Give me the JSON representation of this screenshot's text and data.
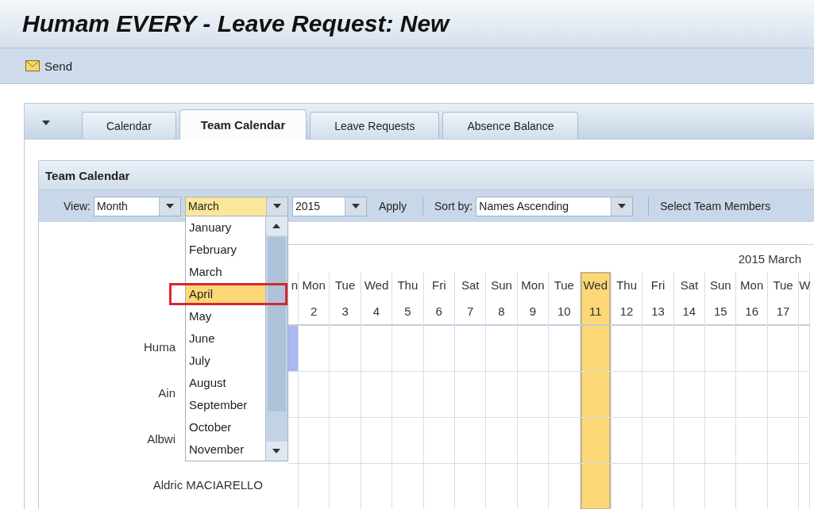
{
  "window": {
    "title": "Humam EVERY - Leave Request: New"
  },
  "toolbar": {
    "buttons": [
      {
        "label": "Send"
      }
    ]
  },
  "tabs": [
    {
      "label": "Calendar",
      "selected": false
    },
    {
      "label": "Team Calendar",
      "selected": true
    },
    {
      "label": "Leave Requests",
      "selected": false
    },
    {
      "label": "Absence Balance",
      "selected": false
    }
  ],
  "panel": {
    "title": "Team Calendar"
  },
  "filters": {
    "view_label": "View:",
    "view_value": "Month",
    "month_value": "March",
    "year_value": "2015",
    "apply": "Apply",
    "sort_label": "Sort by:",
    "sort_value": "Names Ascending",
    "select_members": "Select Team Members"
  },
  "month_dropdown": {
    "expanded": true,
    "options": [
      {
        "label": "January",
        "selected": false
      },
      {
        "label": "February",
        "selected": false
      },
      {
        "label": "March",
        "selected": false
      },
      {
        "label": "April",
        "selected": true
      },
      {
        "label": "May",
        "selected": false
      },
      {
        "label": "June",
        "selected": false
      },
      {
        "label": "July",
        "selected": false
      },
      {
        "label": "August",
        "selected": false
      },
      {
        "label": "September",
        "selected": false
      },
      {
        "label": "October",
        "selected": false
      },
      {
        "label": "November",
        "selected": false
      }
    ]
  },
  "calendar": {
    "month_title": "2015 March",
    "days": [
      {
        "kind": "partial",
        "weekday": "n",
        "today": false
      },
      {
        "kind": "full",
        "weekday": "Mon",
        "date": "2",
        "today": false
      },
      {
        "kind": "full",
        "weekday": "Tue",
        "date": "3",
        "today": false
      },
      {
        "kind": "full",
        "weekday": "Wed",
        "date": "4",
        "today": false
      },
      {
        "kind": "full",
        "weekday": "Thu",
        "date": "5",
        "today": false
      },
      {
        "kind": "full",
        "weekday": "Fri",
        "date": "6",
        "today": false
      },
      {
        "kind": "full",
        "weekday": "Sat",
        "date": "7",
        "today": false
      },
      {
        "kind": "full",
        "weekday": "Sun",
        "date": "8",
        "today": false
      },
      {
        "kind": "full",
        "weekday": "Mon",
        "date": "9",
        "today": false
      },
      {
        "kind": "full",
        "weekday": "Tue",
        "date": "10",
        "today": false
      },
      {
        "kind": "full",
        "weekday": "Wed",
        "date": "11",
        "today": true
      },
      {
        "kind": "full",
        "weekday": "Thu",
        "date": "12",
        "today": false
      },
      {
        "kind": "full",
        "weekday": "Fri",
        "date": "13",
        "today": false
      },
      {
        "kind": "full",
        "weekday": "Sat",
        "date": "14",
        "today": false
      },
      {
        "kind": "full",
        "weekday": "Sun",
        "date": "15",
        "today": false
      },
      {
        "kind": "full",
        "weekday": "Mon",
        "date": "16",
        "today": false
      },
      {
        "kind": "full",
        "weekday": "Tue",
        "date": "17",
        "today": false
      },
      {
        "kind": "partial",
        "weekday": "W",
        "today": false
      }
    ],
    "rows": [
      {
        "name": "Huma",
        "marked": true
      },
      {
        "name": "Ain",
        "marked": false
      },
      {
        "name": "Albwi",
        "marked": false
      },
      {
        "name": "Aldric MACIARELLO",
        "marked": false
      }
    ]
  }
}
